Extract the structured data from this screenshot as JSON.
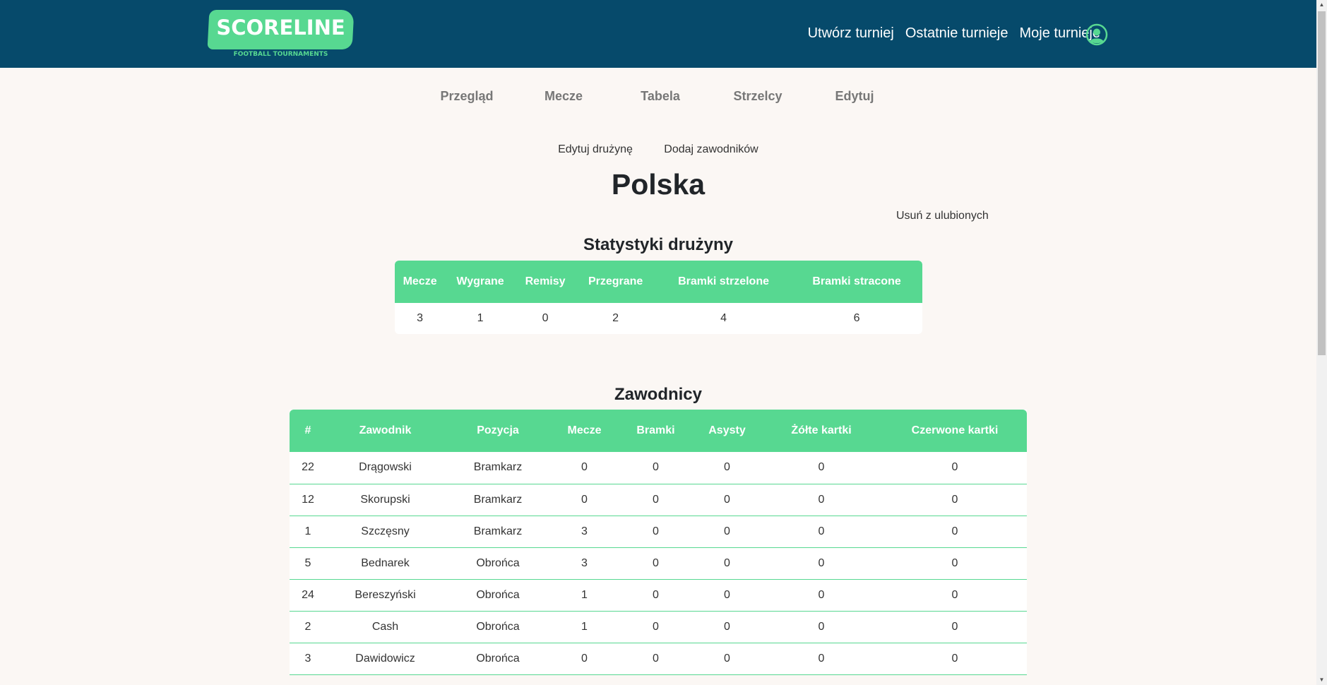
{
  "header": {
    "logo_text": "SCORELINE",
    "logo_subtitle": "FOOTBALL TOURNAMENTS",
    "nav": [
      "Utwórz turniej",
      "Ostatnie turnieje",
      "Moje turnieje"
    ],
    "user_icon": "user-circle-icon",
    "brand_color": "#064a6b",
    "accent_color": "#57d891"
  },
  "tabs": [
    "Przegląd",
    "Mecze",
    "Tabela",
    "Strzelcy",
    "Edytuj"
  ],
  "actions": {
    "edit_team": "Edytuj drużynę",
    "add_players": "Dodaj zawodników",
    "remove_favorite": "Usuń z ulubionych"
  },
  "team": {
    "name": "Polska"
  },
  "team_stats": {
    "title": "Statystyki drużyny",
    "headers": [
      "Mecze",
      "Wygrane",
      "Remisy",
      "Przegrane",
      "Bramki strzelone",
      "Bramki stracone"
    ],
    "values": [
      "3",
      "1",
      "0",
      "2",
      "4",
      "6"
    ]
  },
  "players": {
    "title": "Zawodnicy",
    "headers": [
      "#",
      "Zawodnik",
      "Pozycja",
      "Mecze",
      "Bramki",
      "Asysty",
      "Żółte kartki",
      "Czerwone kartki"
    ],
    "rows": [
      [
        "22",
        "Drągowski",
        "Bramkarz",
        "0",
        "0",
        "0",
        "0",
        "0"
      ],
      [
        "12",
        "Skorupski",
        "Bramkarz",
        "0",
        "0",
        "0",
        "0",
        "0"
      ],
      [
        "1",
        "Szczęsny",
        "Bramkarz",
        "3",
        "0",
        "0",
        "0",
        "0"
      ],
      [
        "5",
        "Bednarek",
        "Obrońca",
        "3",
        "0",
        "0",
        "0",
        "0"
      ],
      [
        "24",
        "Bereszyński",
        "Obrońca",
        "1",
        "0",
        "0",
        "0",
        "0"
      ],
      [
        "2",
        "Cash",
        "Obrońca",
        "1",
        "0",
        "0",
        "0",
        "0"
      ],
      [
        "3",
        "Dawidowicz",
        "Obrońca",
        "0",
        "0",
        "0",
        "0",
        "0"
      ]
    ]
  }
}
